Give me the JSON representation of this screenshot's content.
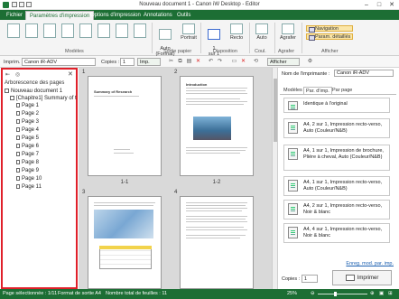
{
  "window": {
    "title": "Nouveau document 1 - Canon iW Desktop - Editor",
    "minimize_glyph": "–",
    "maximize_glyph": "□",
    "close_glyph": "✕"
  },
  "tabs": [
    "Fichier",
    "Paramètres d'impression",
    "Options d'impression",
    "Annotations",
    "Outils"
  ],
  "ribbon": {
    "models_label": "Modèles",
    "paper_output_label": "Sortie papier",
    "layout_label": "Disposition",
    "color_label": "Coul.",
    "finishing_label": "Agrafer",
    "display_label": "Afficher",
    "btn_auto_format": "Auto\n(Format)",
    "btn_portrait": "Portrait",
    "btn_one_per_sheet": "1\nsur 1",
    "btn_recto": "Recto",
    "btn_auto_color": "Auto",
    "btn_staple": "Agrafer",
    "nav_navigation": "Navigation",
    "nav_details": "Param. détaillés"
  },
  "printer_bar": {
    "printer_label": "Imprim. :",
    "printer_value": "Canon iR-ADV",
    "copies_label": "Copies :",
    "copies_value": "1",
    "print_button": "Imp.",
    "display_button": "Afficher"
  },
  "tree": {
    "title": "Arborescence des pages",
    "items": [
      "Nouveau document 1",
      "[Chapitre1] Summary of t",
      "Page 1",
      "Page 2",
      "Page 3",
      "Page 4",
      "Page 5",
      "Page 6",
      "Page 7",
      "Page 8",
      "Page 9",
      "Page 10",
      "Page 11"
    ]
  },
  "preview": {
    "pages": [
      {
        "number": "1",
        "caption": "1-1",
        "heading": "Summary of Research"
      },
      {
        "number": "2",
        "caption": "1-2",
        "heading": "Introduction"
      },
      {
        "number": "3",
        "caption": "",
        "heading": ""
      },
      {
        "number": "4",
        "caption": "",
        "heading": ""
      }
    ]
  },
  "right_panel": {
    "printer_label": "Nom de l'imprimante :",
    "printer_value": "Canon iR-ADV",
    "tabs": [
      "Modèles",
      "Par. d'imp.",
      "Par page"
    ],
    "favorites": [
      "Identique à l'original",
      "A4, 2 sur 1, Impression recto-verso, Auto (Couleur/N&B)",
      "A4, 1 sur 1, Impression de brochure, Pliére à cheval, Auto (Couleur/N&B)",
      "A4, 1 sur 1, Impression recto-verso, Auto (Couleur/N&B)",
      "A4, 2 sur 1, Impression recto-verso, Noir & blanc",
      "A4, 4 sur 1, Impression recto-verso, Noir & blanc"
    ],
    "link": "Enreg. mod. par. imp.",
    "copies_label": "Copies :",
    "copies_value": "1",
    "print_button": "Imprimer"
  },
  "status_bar": {
    "selected_page": "Page sélectionnée : 1/11",
    "paper_format": "Format de sortie A4",
    "total_sheets": "Nombre total de feuilles : 11",
    "zoom": "25%"
  },
  "colors": {
    "accent": "#1c6e34",
    "highlight": "#e0202a"
  }
}
